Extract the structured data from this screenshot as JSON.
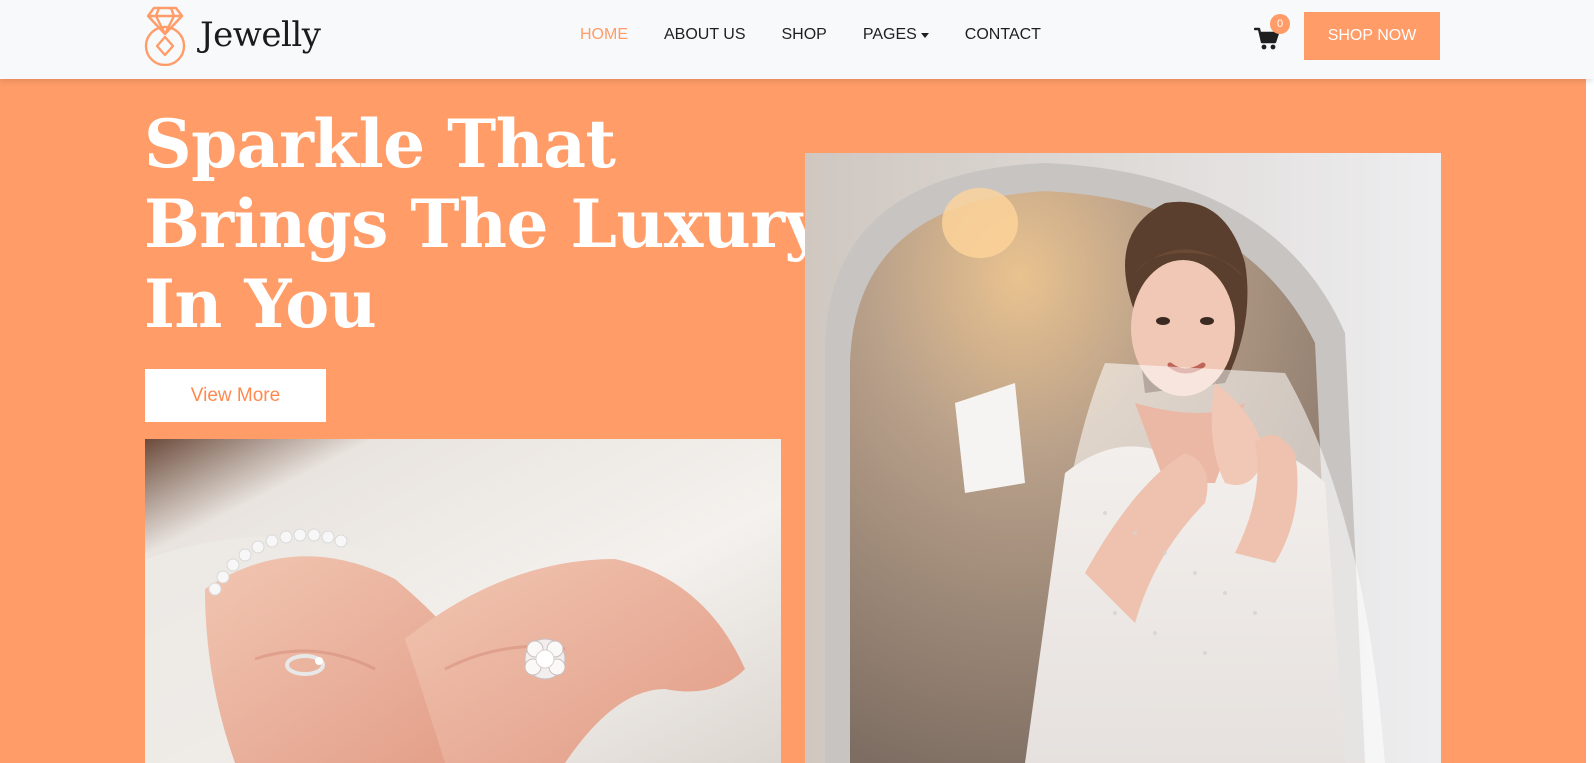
{
  "brand": {
    "name": "Jewelly",
    "logo_icon": "ring-diamond-icon",
    "accent_color": "#ff9c68"
  },
  "nav": {
    "items": [
      {
        "label": "HOME",
        "active": true
      },
      {
        "label": "ABOUT US",
        "active": false
      },
      {
        "label": "SHOP",
        "active": false
      },
      {
        "label": "PAGES",
        "active": false,
        "dropdown": true
      },
      {
        "label": "CONTACT",
        "active": false
      }
    ],
    "cart_count": "0",
    "shop_now_label": "SHOP NOW"
  },
  "hero": {
    "title_lines": [
      "Sparkle That",
      "Brings The Luxury",
      "In You"
    ],
    "cta_label": "View More",
    "background_color": "#ff9c68"
  }
}
